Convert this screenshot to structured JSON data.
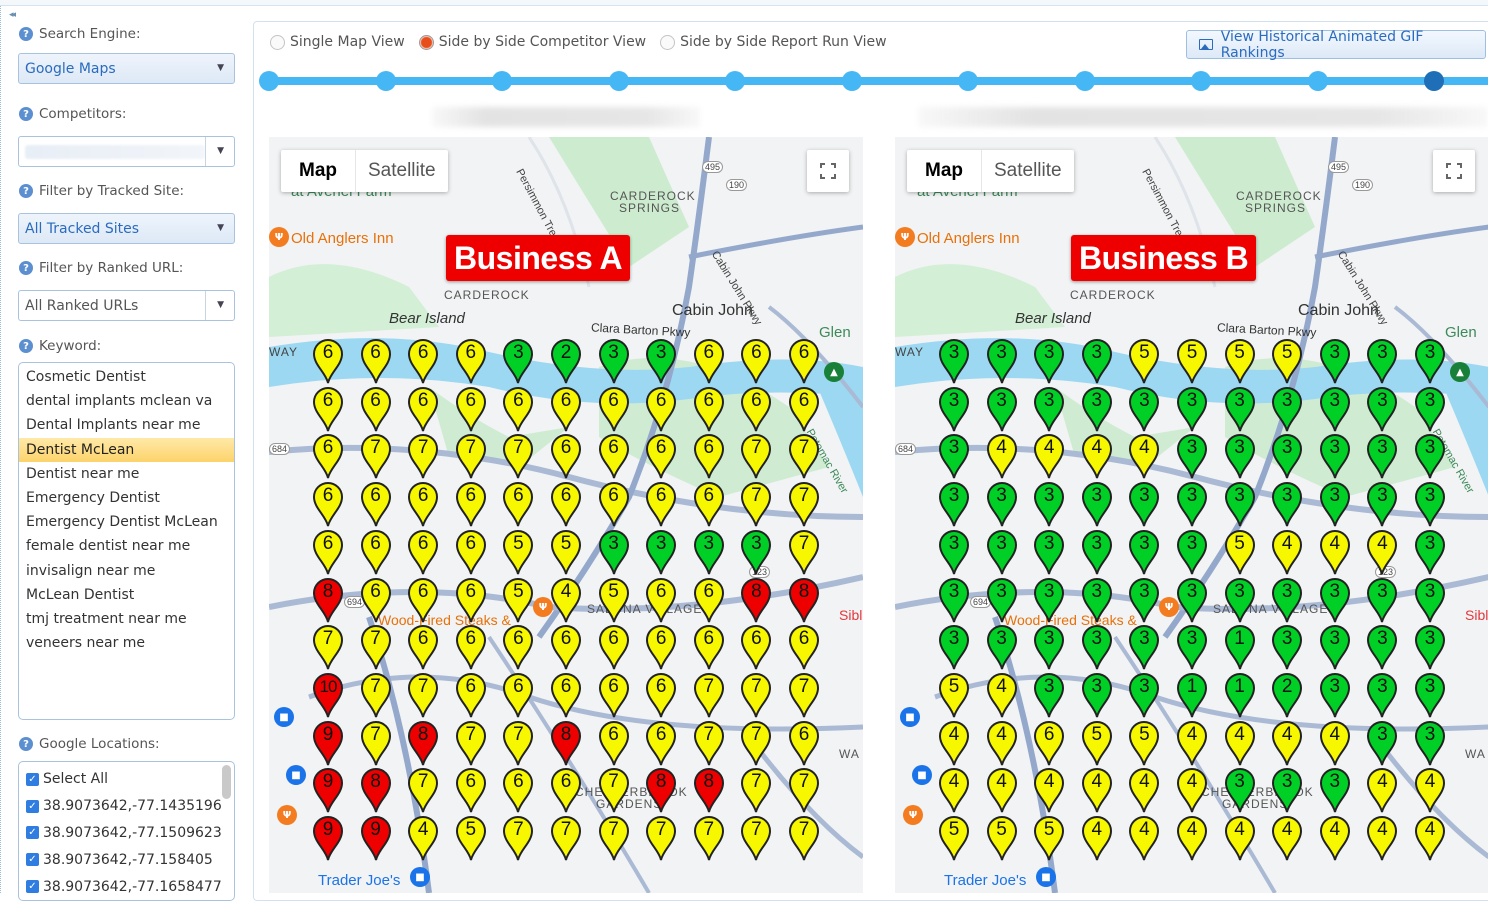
{
  "sidebar": {
    "collapse_label": "◂◂",
    "search_engine": {
      "label": "Search Engine:",
      "value": "Google Maps"
    },
    "competitors": {
      "label": "Competitors:",
      "value": ""
    },
    "tracked_site": {
      "label": "Filter by Tracked Site:",
      "value": "All Tracked Sites"
    },
    "ranked_url": {
      "label": "Filter by Ranked URL:",
      "value": "All Ranked URLs"
    },
    "keyword": {
      "label": "Keyword:",
      "selected": "Dentist McLean",
      "items": [
        "Cosmetic Dentist",
        "dental implants mclean va",
        "Dental Implants near me",
        "Dentist McLean",
        "Dentist near me",
        "Emergency Dentist",
        "Emergency Dentist McLean",
        "female dentist near me",
        "invisalign near me",
        "McLean Dentist",
        "tmj treatment near me",
        "veneers near me"
      ]
    },
    "locations": {
      "label": "Google Locations:",
      "items": [
        {
          "label": "Select All",
          "checked": true
        },
        {
          "label": "38.9073642,-77.1435196",
          "checked": true
        },
        {
          "label": "38.9073642,-77.1509623",
          "checked": true
        },
        {
          "label": "38.9073642,-77.158405",
          "checked": true
        },
        {
          "label": "38.9073642,-77.1658477",
          "checked": true
        }
      ]
    }
  },
  "view_options": {
    "radios": [
      {
        "label": "Single Map View",
        "selected": false
      },
      {
        "label": "Side by Side Competitor View",
        "selected": true
      },
      {
        "label": "Side by Side Report Run View",
        "selected": false
      }
    ],
    "gif_button": "View Historical Animated GIF Rankings"
  },
  "timeline": {
    "node_count": 11,
    "current_index": 10
  },
  "map_controls": {
    "map": "Map",
    "satellite": "Satellite"
  },
  "map_places": {
    "old_anglers": "Old Anglers Inn",
    "avenel": "at Avenel Farm",
    "carderock_springs_1": "CARDEROCK",
    "carderock_springs_2": "SPRINGS",
    "carderock": "CARDEROCK",
    "bear_island": "Bear Island",
    "cabin_john": "Cabin John",
    "clara_barton": "Clara Barton Pkwy",
    "glen_echo": "Glen",
    "way": "WAY",
    "persimmon": "Persimmon Tree Rd",
    "cabin_john_pkwy": "Cabin John Pkwy",
    "trader_joes": "Trader Joe's",
    "potomac": "Potomac River",
    "route_495": "495",
    "route_190": "190",
    "route_684": "684",
    "route_694": "694",
    "route_123": "123",
    "salona": "SALONA VILLAGE",
    "chesterbrook_1": "CHESTERBROOK",
    "chesterbrook_2": "GARDENS",
    "wood_fired": "Wood-Fired Steaks &",
    "sibley": "Sibl",
    "wa": "WA"
  },
  "colors": {
    "green": "#00d026",
    "yellow": "#f7f700",
    "red": "#ee0000",
    "brand_blue": "#2a6bbf",
    "timeline": "#46b7f5"
  },
  "rank_thresholds": {
    "green_max": 3,
    "yellow_max": 7,
    "red_min": 8
  },
  "maps": [
    {
      "business": "Business A",
      "grid": [
        [
          6,
          6,
          6,
          6,
          3,
          2,
          3,
          3,
          6,
          6,
          6
        ],
        [
          6,
          6,
          6,
          6,
          6,
          6,
          6,
          6,
          6,
          6,
          6
        ],
        [
          6,
          7,
          7,
          7,
          7,
          6,
          6,
          6,
          6,
          7,
          7
        ],
        [
          6,
          6,
          6,
          6,
          6,
          6,
          6,
          6,
          6,
          7,
          7
        ],
        [
          6,
          6,
          6,
          6,
          5,
          5,
          3,
          3,
          3,
          3,
          7
        ],
        [
          8,
          6,
          6,
          6,
          5,
          4,
          5,
          6,
          6,
          8,
          8
        ],
        [
          7,
          7,
          6,
          6,
          6,
          6,
          6,
          6,
          6,
          6,
          6
        ],
        [
          10,
          7,
          7,
          6,
          6,
          6,
          6,
          6,
          7,
          7,
          7
        ],
        [
          9,
          7,
          8,
          7,
          7,
          8,
          6,
          6,
          7,
          7,
          6
        ],
        [
          9,
          8,
          7,
          6,
          6,
          6,
          7,
          8,
          8,
          7,
          7
        ],
        [
          9,
          9,
          4,
          5,
          7,
          7,
          7,
          7,
          7,
          7,
          7
        ]
      ]
    },
    {
      "business": "Business B",
      "grid": [
        [
          3,
          3,
          3,
          3,
          5,
          5,
          5,
          5,
          3,
          3,
          3
        ],
        [
          3,
          3,
          3,
          3,
          3,
          3,
          3,
          3,
          3,
          3,
          3
        ],
        [
          3,
          4,
          4,
          4,
          4,
          3,
          3,
          3,
          3,
          3,
          3
        ],
        [
          3,
          3,
          3,
          3,
          3,
          3,
          3,
          3,
          3,
          3,
          3
        ],
        [
          3,
          3,
          3,
          3,
          3,
          3,
          5,
          4,
          4,
          4,
          3
        ],
        [
          3,
          3,
          3,
          3,
          3,
          3,
          3,
          3,
          3,
          3,
          3
        ],
        [
          3,
          3,
          3,
          3,
          3,
          3,
          1,
          3,
          3,
          3,
          3
        ],
        [
          5,
          4,
          3,
          3,
          3,
          1,
          1,
          2,
          3,
          3,
          3
        ],
        [
          4,
          4,
          6,
          5,
          5,
          4,
          4,
          4,
          4,
          3,
          3
        ],
        [
          4,
          4,
          4,
          4,
          4,
          4,
          3,
          3,
          3,
          4,
          4
        ],
        [
          5,
          5,
          5,
          4,
          4,
          4,
          4,
          4,
          4,
          4,
          4
        ]
      ]
    }
  ]
}
